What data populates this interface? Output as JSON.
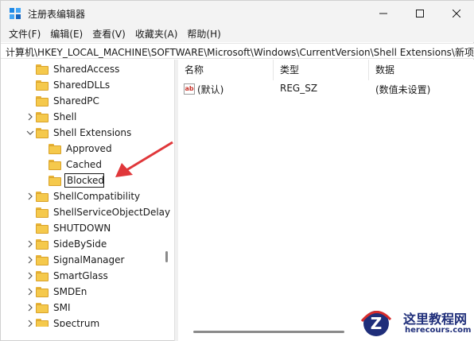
{
  "window": {
    "title": "注册表编辑器",
    "controls": {
      "minimize_icon": "minimize-icon",
      "maximize_icon": "maximize-icon",
      "close_icon": "close-icon"
    }
  },
  "menu": [
    "文件(F)",
    "编辑(E)",
    "查看(V)",
    "收藏夹(A)",
    "帮助(H)"
  ],
  "address": "计算机\\HKEY_LOCAL_MACHINE\\SOFTWARE\\Microsoft\\Windows\\CurrentVersion\\Shell Extensions\\新项",
  "tree": {
    "items": [
      {
        "label": "SharedAccess",
        "chevron": ""
      },
      {
        "label": "SharedDLLs",
        "chevron": ""
      },
      {
        "label": "SharedPC",
        "chevron": ""
      },
      {
        "label": "Shell",
        "chevron": "right"
      },
      {
        "label": "Shell Extensions",
        "chevron": "down"
      },
      {
        "label": "Approved",
        "chevron": ""
      },
      {
        "label": "Cached",
        "chevron": ""
      },
      {
        "label": "Blocked",
        "chevron": "",
        "editing": true
      },
      {
        "label": "ShellCompatibility",
        "chevron": "right"
      },
      {
        "label": "ShellServiceObjectDelay",
        "chevron": ""
      },
      {
        "label": "SHUTDOWN",
        "chevron": ""
      },
      {
        "label": "SideBySide",
        "chevron": "right"
      },
      {
        "label": "SignalManager",
        "chevron": "right"
      },
      {
        "label": "SmartGlass",
        "chevron": "right"
      },
      {
        "label": "SMDEn",
        "chevron": "right"
      },
      {
        "label": "SMI",
        "chevron": "right"
      },
      {
        "label": "Spectrum",
        "chevron": "right"
      }
    ]
  },
  "list": {
    "headers": {
      "name": "名称",
      "type": "类型",
      "data": "数据"
    },
    "rows": [
      {
        "icon": "ab",
        "name": "(默认)",
        "type": "REG_SZ",
        "data": "(数值未设置)"
      }
    ]
  },
  "watermark": {
    "name": "这里教程网",
    "url": "herecours.com"
  },
  "colors": {
    "folder": "#f5c94c",
    "arrow": "#e0373a",
    "watermark": "#1f2e7a"
  }
}
